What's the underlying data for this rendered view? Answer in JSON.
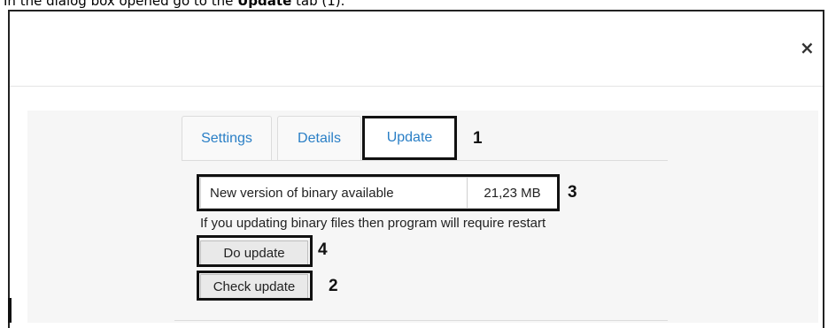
{
  "caption": {
    "prefix": "In the dialog box opened go to the ",
    "bold": "Update",
    "suffix": " tab (1)."
  },
  "dialog": {
    "close_icon": "×"
  },
  "tabs": [
    {
      "label": "Settings"
    },
    {
      "label": "Details"
    },
    {
      "label": "Update"
    }
  ],
  "update": {
    "binary_label": "New version of binary available",
    "binary_size": "21,23 MB",
    "restart_note": "If you updating binary files then program will require restart",
    "do_update": "Do update",
    "check_update": "Check update"
  },
  "callouts": {
    "one": "1",
    "two": "2",
    "three": "3",
    "four": "4"
  }
}
